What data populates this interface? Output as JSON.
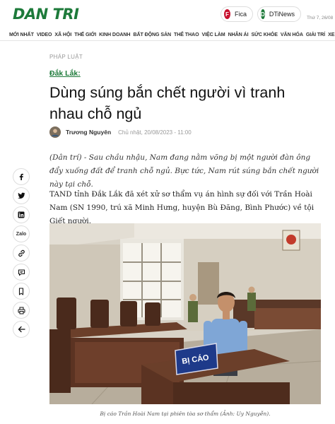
{
  "header": {
    "logo": "DAN TRI",
    "fica_label": "Fica",
    "fica_icon": "F",
    "dtinews_label": "DTiNews",
    "dtinews_icon": "D",
    "date": "Thứ 7, 26/08"
  },
  "nav": {
    "items": [
      "MỚI NHẤT",
      "VIDEO",
      "XÃ HỘI",
      "THẾ GIỚI",
      "KINH DOANH",
      "BẤT ĐỘNG SẢN",
      "THỂ THAO",
      "VIỆC LÀM",
      "NHÂN ÁI",
      "SỨC KHỎE",
      "VĂN HÓA",
      "GIẢI TRÍ",
      "XE +"
    ]
  },
  "share": {
    "zalo": "Zalo"
  },
  "article": {
    "breadcrumb": "PHÁP LUẬT",
    "category": "Đắk Lắk:",
    "title": "Dùng súng bắn chết người vì tranh nhau chỗ ngủ",
    "author": "Trương Nguyên",
    "updated": "Chủ nhật, 20/08/2023 - 11:00",
    "sapo": "(Dân trí) - Sau chầu nhậu, Nam đang nằm võng bị một người đàn ông đẩy xuống đất để tranh chỗ ngủ. Bực tức, Nam rút súng bắn chết người này tại chỗ.",
    "paragraph": "TAND tỉnh Đắk Lắk đã xét xử sơ thẩm vụ án hình sự đối với Trần Hoài Nam (SN 1990, trú xã Minh Hưng, huyện Bù Đăng, Bình Phước) về tội Giết người.",
    "photo_sign": "BỊ CÁO",
    "caption": "Bị cáo Trần Hoài Nam tại phiên tòa sơ thẩm (Ảnh: Uy Nguyễn)."
  },
  "colors": {
    "brand_green": "#1d7a3a",
    "fica_red": "#c8102e"
  }
}
